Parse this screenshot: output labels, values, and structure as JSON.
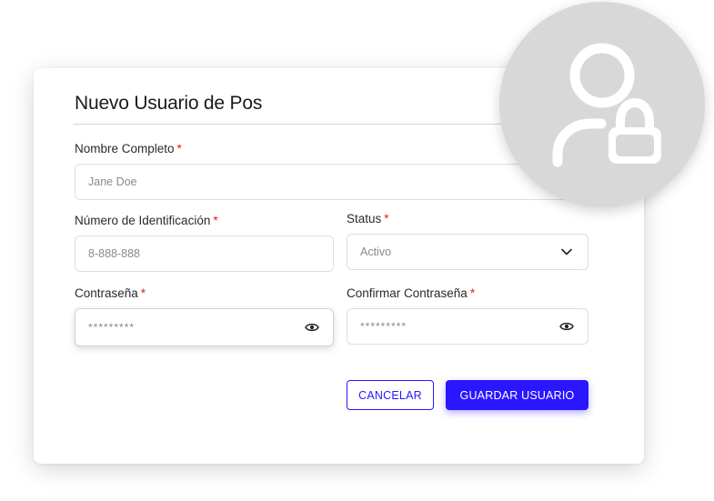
{
  "form": {
    "title": "Nuevo Usuario de Pos",
    "required_mark": "*",
    "full_name": {
      "label": "Nombre Completo",
      "placeholder": "Jane Doe"
    },
    "id_number": {
      "label": "Número de Identificación",
      "placeholder": "8-888-888"
    },
    "status": {
      "label": "Status",
      "selected": "Activo",
      "icon": "chevron-down-icon"
    },
    "password": {
      "label": "Contraseña",
      "value": "*********",
      "icon": "eye-icon"
    },
    "confirm_password": {
      "label": "Confirmar Contraseña",
      "value": "*********",
      "icon": "eye-icon"
    },
    "buttons": {
      "cancel": "CANCELAR",
      "save": "GUARDAR USUARIO"
    }
  },
  "decoration": {
    "icon": "user-lock-icon"
  },
  "colors": {
    "accent": "#2a16ff",
    "required": "#e02020",
    "avatar_bg": "#d8d8d8"
  }
}
